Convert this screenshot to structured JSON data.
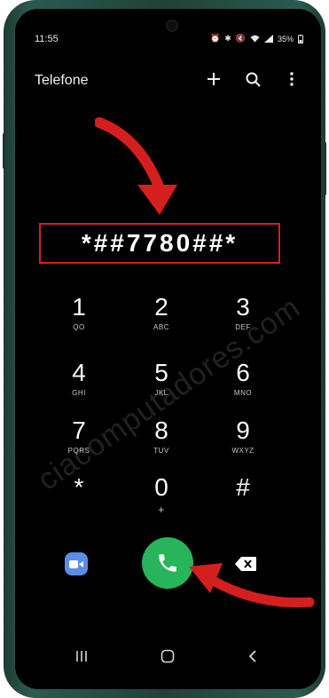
{
  "status": {
    "time": "11:55",
    "battery": "35%"
  },
  "app": {
    "title": "Telefone"
  },
  "dialer": {
    "code": "*##7780##*"
  },
  "keys": [
    {
      "digit": "1",
      "letters": "QO"
    },
    {
      "digit": "2",
      "letters": "ABC"
    },
    {
      "digit": "3",
      "letters": "DEF"
    },
    {
      "digit": "4",
      "letters": "GHI"
    },
    {
      "digit": "5",
      "letters": "JKL"
    },
    {
      "digit": "6",
      "letters": "MNO"
    },
    {
      "digit": "7",
      "letters": "PQRS"
    },
    {
      "digit": "8",
      "letters": "TUV"
    },
    {
      "digit": "9",
      "letters": "WXYZ"
    },
    {
      "digit": "*",
      "letters": ""
    },
    {
      "digit": "0",
      "letters": "+"
    },
    {
      "digit": "#",
      "letters": ""
    }
  ],
  "watermark": "ciacomputadores.com",
  "icons": {
    "add": "plus-icon",
    "search": "search-icon",
    "more": "more-vertical-icon",
    "video": "video-call-icon",
    "call": "phone-icon",
    "delete": "backspace-icon",
    "recents": "recents-icon",
    "home": "home-icon",
    "back": "back-icon"
  },
  "colors": {
    "call": "#27b45a",
    "video": "#5b8ee6",
    "highlight": "#d41f1f",
    "arrow": "#d41f1f"
  }
}
